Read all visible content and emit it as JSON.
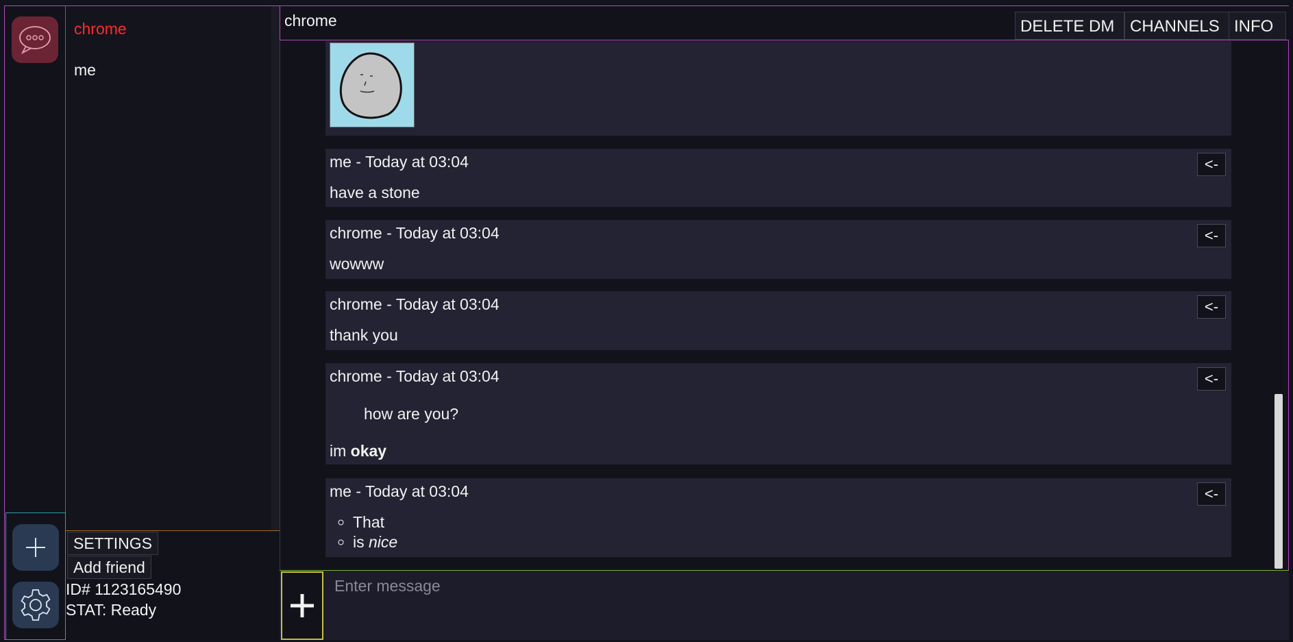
{
  "colors": {
    "accent_red": "#ff2a2a",
    "frame_magenta": "#b04ab8",
    "bubble_bg": "#232333"
  },
  "dm_list": {
    "items": [
      {
        "label": "chrome"
      },
      {
        "label": "me"
      }
    ]
  },
  "user_panel": {
    "settings_label": "SETTINGS",
    "add_friend_label": "Add friend",
    "id_text": "ID# 1123165490",
    "status_text": "STAT: Ready"
  },
  "header": {
    "title": "chrome",
    "delete_dm_label": "DELETE DM",
    "channels_label": "CHANNELS",
    "info_label": "INFO"
  },
  "messages": [
    {
      "type": "image",
      "icon": "stone-drawing"
    },
    {
      "author_line": "me - Today at 03:04",
      "body": "have a stone",
      "reply_label": "<-"
    },
    {
      "author_line": "chrome - Today at 03:04",
      "body": "wowww",
      "reply_label": "<-"
    },
    {
      "author_line": "chrome - Today at 03:04",
      "body": "thank you",
      "reply_label": "<-"
    },
    {
      "author_line": "chrome - Today at 03:04",
      "quote": "how are you?",
      "body_plain": "im ",
      "body_bold": "okay",
      "reply_label": "<-"
    },
    {
      "author_line": "me - Today at 03:04",
      "list": [
        {
          "text": "That"
        },
        {
          "text_plain": "is ",
          "text_italic": "nice"
        }
      ],
      "reply_label": "<-"
    }
  ],
  "composer": {
    "placeholder": "Enter message",
    "attach_icon": "plus-icon"
  },
  "rail": {
    "dm_icon": "chat-bubble-icon",
    "add_icon": "plus-icon",
    "settings_icon": "gear-icon"
  }
}
